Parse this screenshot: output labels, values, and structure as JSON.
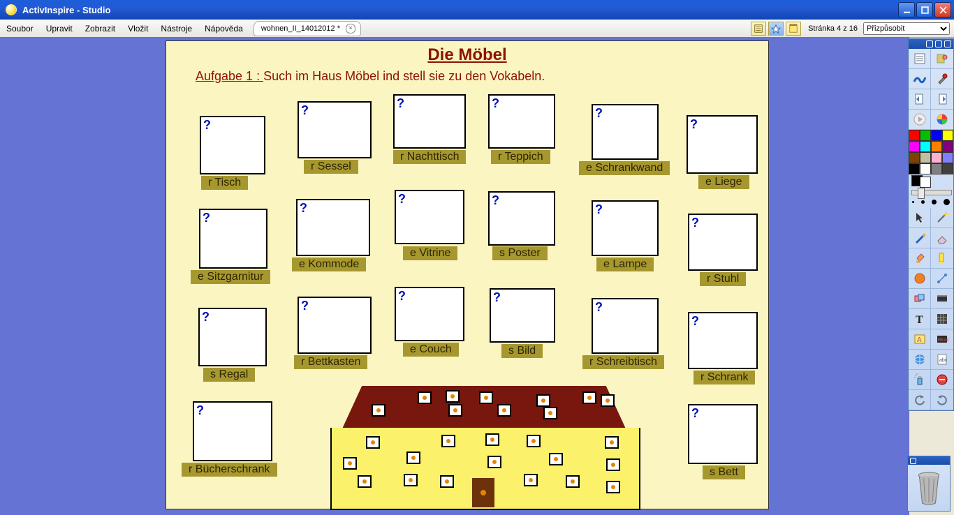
{
  "app_title": "ActivInspire - Studio",
  "menu": [
    "Soubor",
    "Upravit",
    "Zobrazit",
    "Vložit",
    "Nástroje",
    "Nápověda"
  ],
  "tab_name": "wohnen_II_14012012 *",
  "page_indicator": "Stránka 4 z 16",
  "zoom_value": "Přizpůsobit",
  "lesson": {
    "title": "Die Möbel",
    "task_label": "Aufgabe 1 : ",
    "task_text": "Such im Haus Möbel ind stell sie zu den Vokabeln."
  },
  "items": {
    "tisch": "r Tisch",
    "sessel": "r Sessel",
    "nachttisch": "r Nachttisch",
    "teppich": "r Teppich",
    "schrankwand": "e Schrankwand",
    "liege": "e Liege",
    "sitzgarnitur": "e Sitzgarnitur",
    "kommode": "e Kommode",
    "vitrine": "e Vitrine",
    "poster": "s Poster",
    "lampe": "e Lampe",
    "stuhl": "r Stuhl",
    "regal": "s Regal",
    "bettkasten": "r Bettkasten",
    "couch": "e Couch",
    "bild": "s Bild",
    "schreibtisch": "r Schreibtisch",
    "schrank": "r Schrank",
    "buecherschrank": "r Bücherschrank",
    "bett": "s Bett"
  },
  "qmark": "?",
  "palette": [
    "#ff0000",
    "#00c000",
    "#0000ff",
    "#ffff00",
    "#ff00ff",
    "#00ffff",
    "#ff8000",
    "#800080",
    "#804000",
    "#c0c0a0",
    "#ffb0d0",
    "#8080ff",
    "#000000",
    "#ffffff",
    "#808080",
    "#404040"
  ]
}
